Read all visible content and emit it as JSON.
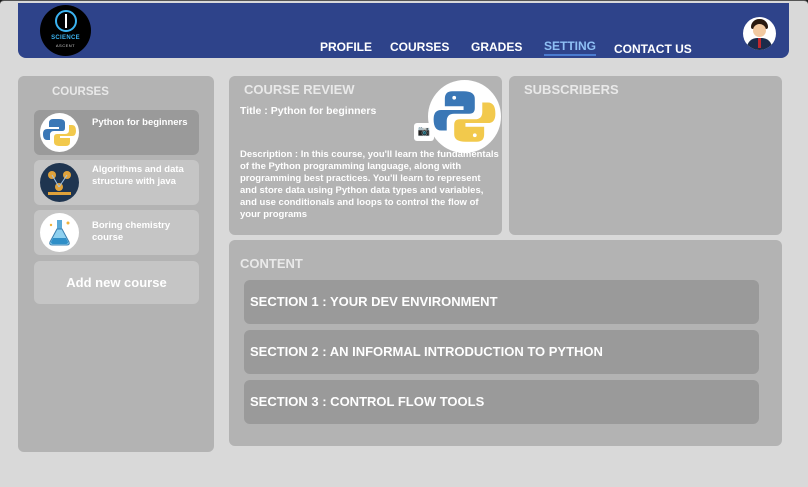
{
  "header": {
    "logo": {
      "word": "SCIENCE",
      "sub": "ASCENT",
      "icon": "brain-logo-icon"
    },
    "nav": [
      {
        "label": "PROFILE"
      },
      {
        "label": "COURSES"
      },
      {
        "label": "GRADES"
      },
      {
        "label": "SETTING",
        "active": true
      },
      {
        "label": "CONTACT US"
      }
    ],
    "avatar_icon": "user-avatar-icon",
    "colors": {
      "bar": "#2e438a",
      "active_link": "#8fc0f5"
    }
  },
  "sidebar": {
    "title": "COURSES",
    "courses": [
      {
        "label": "Python for beginners",
        "icon": "python-logo-icon",
        "selected": true
      },
      {
        "label": "Algorithms and data structure with java",
        "icon": "algorithms-thumbnail-icon"
      },
      {
        "label": "Boring chemistry course",
        "icon": "chemistry-flask-icon"
      }
    ],
    "add_button": "Add new course"
  },
  "review": {
    "title": "COURSE REVIEW",
    "course_title": "Title : Python for beginners",
    "description": "Description : In this course, you'll learn the fundamentals of the Python programming language, along with programming best practices. You'll learn to represent and store data using Python data types and variables, and use conditionals and loops to control the flow of your programs",
    "camera_icon": "camera-icon"
  },
  "subscribers": {
    "title": "SUBSCRIBERS"
  },
  "content": {
    "title": "CONTENT",
    "sections": [
      {
        "label": "SECTION 1 :  YOUR DEV ENVIRONMENT"
      },
      {
        "label": "SECTION 2 :  AN INFORMAL INTRODUCTION TO PYTHON"
      },
      {
        "label": "SECTION 3 :  CONTROL FLOW TOOLS"
      }
    ]
  }
}
